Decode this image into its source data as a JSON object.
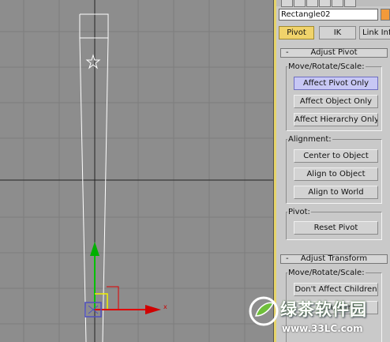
{
  "object_name": "Rectangle02",
  "colors": {
    "swatch": "#f29a3a",
    "active_tab": "#f0d36b",
    "active_button": "#c7c7f4"
  },
  "tabs": [
    {
      "label": "Pivot",
      "active": true
    },
    {
      "label": "IK",
      "active": false
    },
    {
      "label": "Link Info",
      "active": false
    }
  ],
  "adjust_pivot": {
    "title": "Adjust Pivot",
    "collapse": "-",
    "move_group": {
      "label": "Move/Rotate/Scale:",
      "buttons": [
        "Affect Pivot Only",
        "Affect Object Only",
        "Affect Hierarchy Only"
      ]
    },
    "alignment_group": {
      "label": "Alignment:",
      "buttons": [
        "Center to Object",
        "Align to Object",
        "Align to World"
      ]
    },
    "pivot_group": {
      "label": "Pivot:",
      "buttons": [
        "Reset Pivot"
      ]
    }
  },
  "adjust_transform": {
    "title": "Adjust Transform",
    "collapse": "-",
    "move_group": {
      "label": "Move/Rotate/Scale:",
      "buttons": [
        "Don't Affect Children",
        "Transform"
      ]
    }
  },
  "gizmo": {
    "x_axis_label": "x"
  },
  "watermark": {
    "title": "绿茶软件园",
    "url": "www.33LC.com"
  }
}
